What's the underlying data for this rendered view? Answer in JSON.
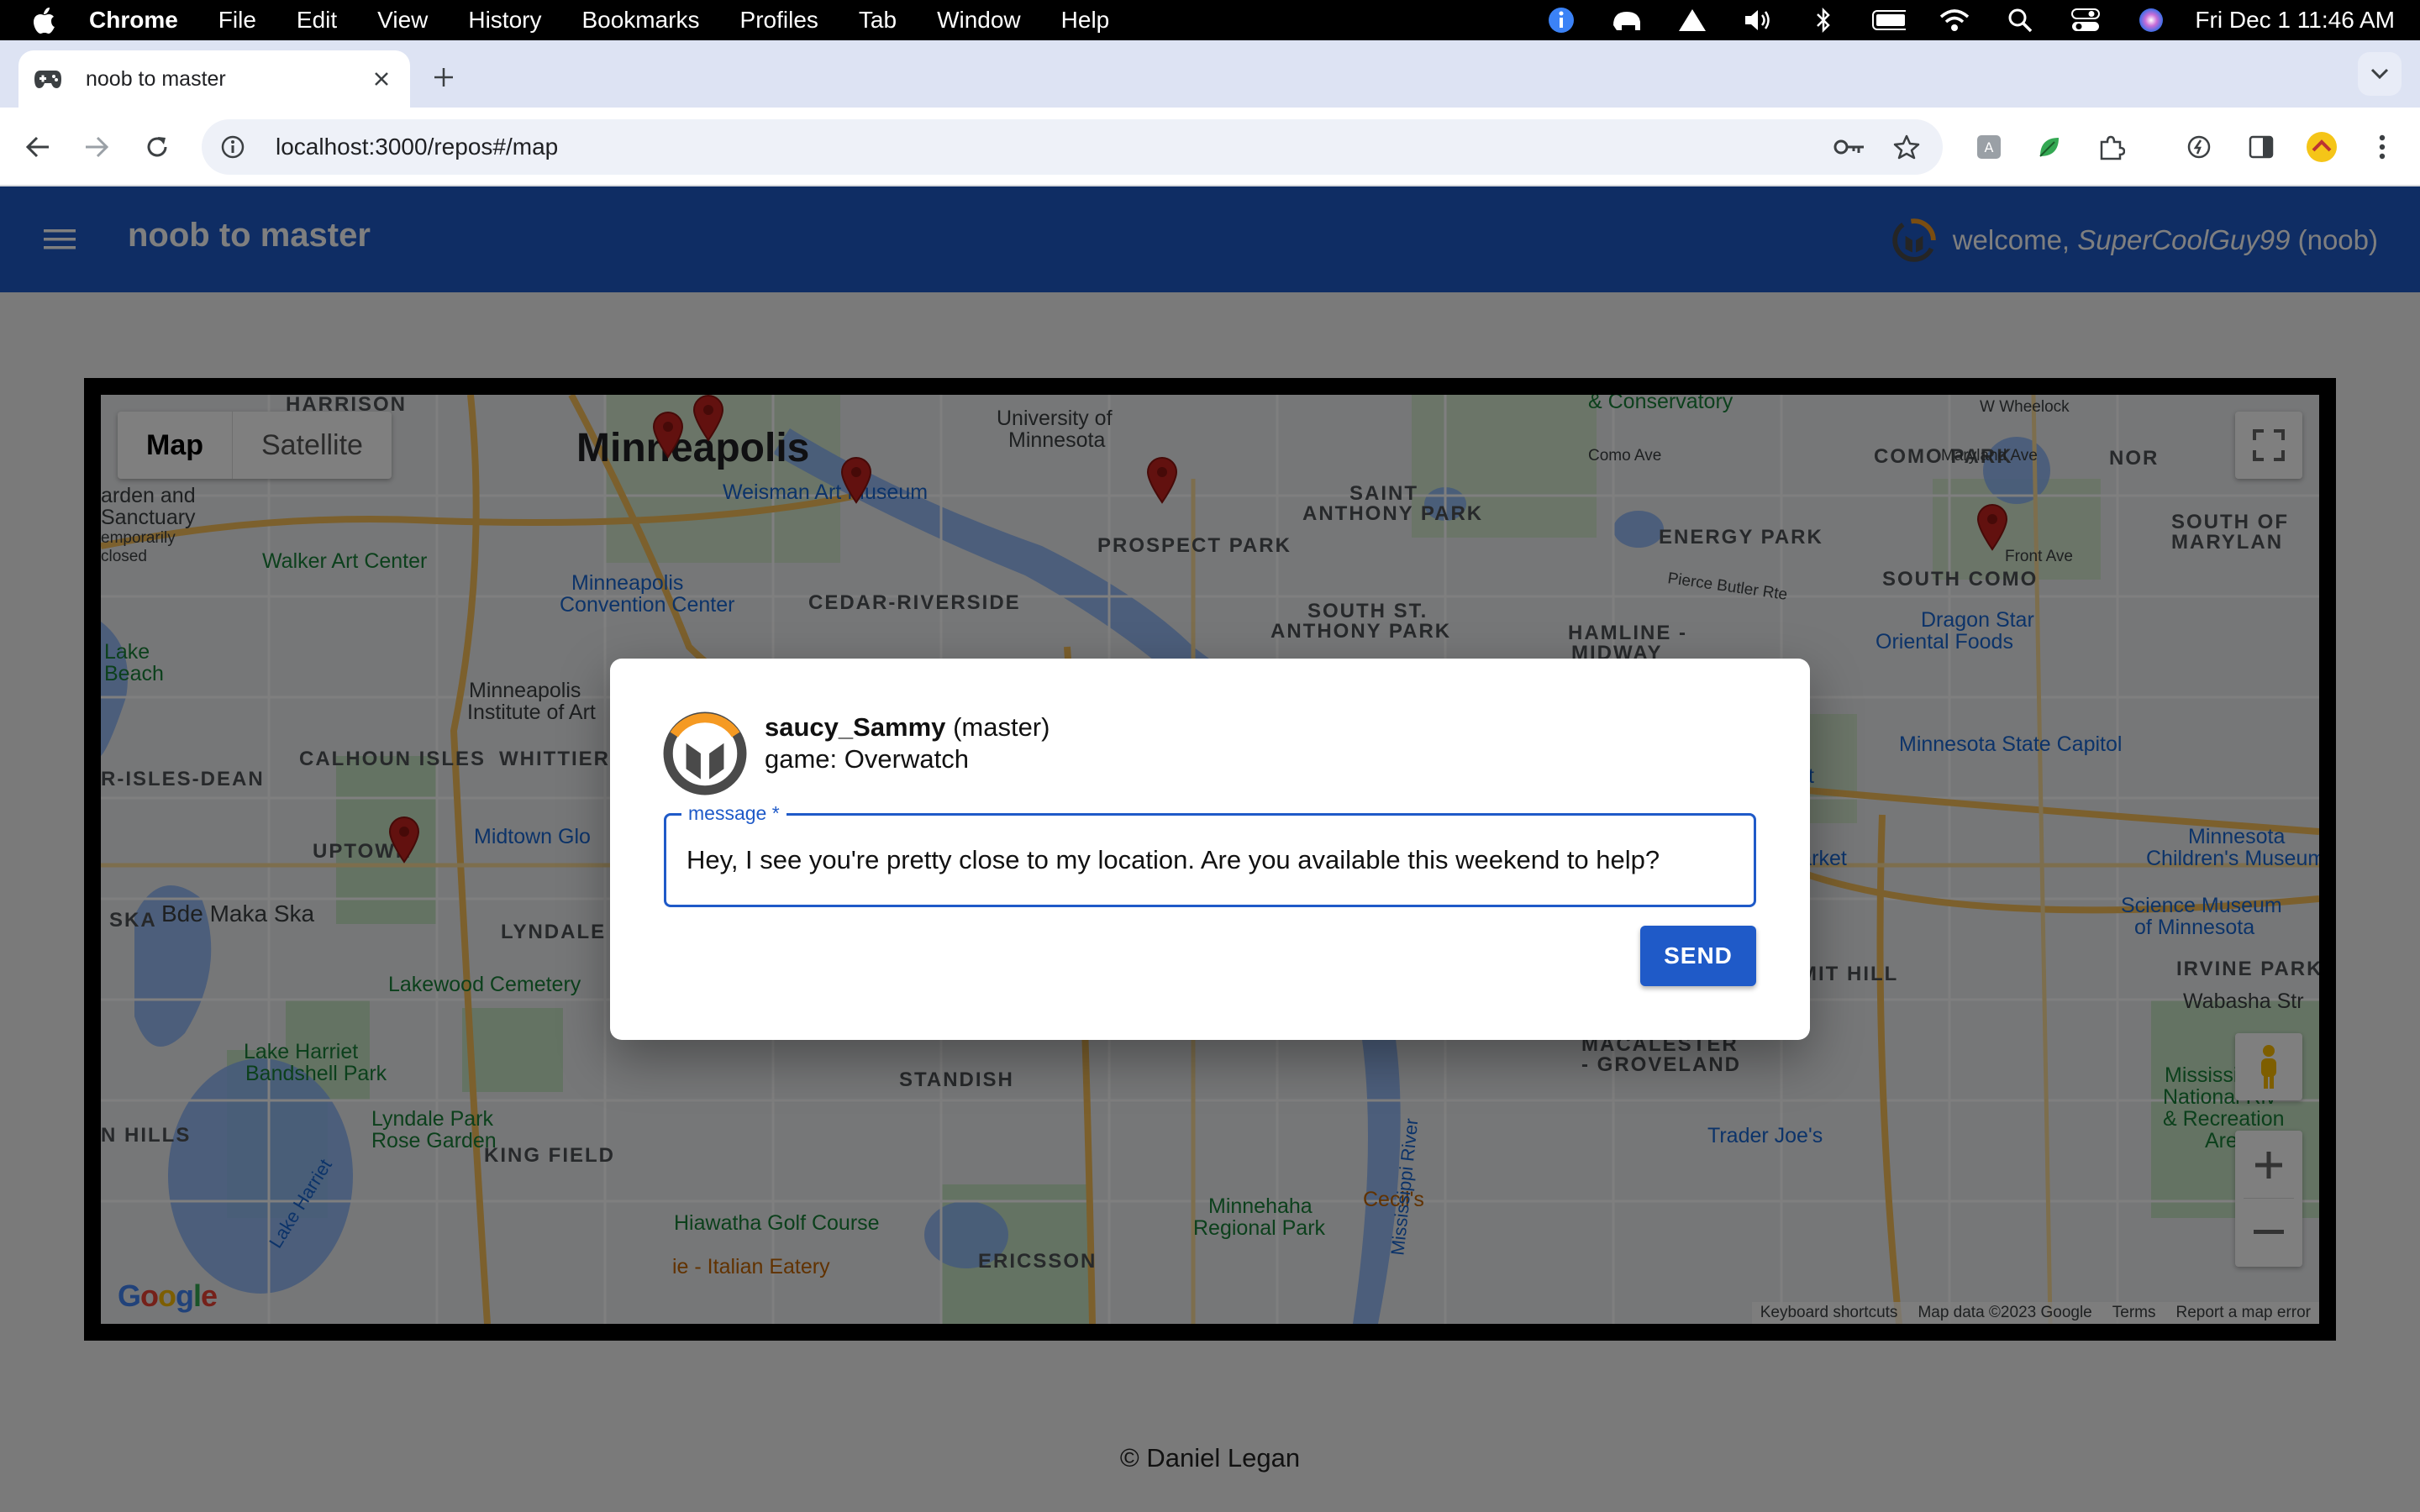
{
  "menubar": {
    "app_name": "Chrome",
    "items": [
      "File",
      "Edit",
      "View",
      "History",
      "Bookmarks",
      "Profiles",
      "Tab",
      "Window",
      "Help"
    ],
    "clock": "Fri Dec 1  11:46 AM"
  },
  "browser": {
    "tab_title": "noob to master",
    "url": "localhost:3000/repos#/map"
  },
  "app": {
    "brand": "noob to master",
    "welcome_prefix": "welcome,",
    "username": "SuperCoolGuy99",
    "user_rank": "(noob)",
    "footer": "© Daniel Legan"
  },
  "map": {
    "type_map": "Map",
    "type_satellite": "Satellite",
    "google": "Google",
    "attribution": {
      "shortcuts": "Keyboard shortcuts",
      "data": "Map data ©2023 Google",
      "terms": "Terms",
      "report": "Report a map error"
    },
    "labels": {
      "minneapolis": "Minneapolis",
      "harrison": "HARRISON",
      "university": "University of",
      "university2": "Minnesota",
      "weisman": "Weisman Art Museum",
      "saint_anthony_park": "SAINT",
      "saint_anthony_park2": "ANTHONY PARK",
      "prospect_park": "PROSPECT PARK",
      "como_park": "COMO PARK",
      "energy_park": "ENERGY PARK",
      "south_como": "SOUTH COMO",
      "walker": "Walker Art Center",
      "convention": "Minneapolis",
      "convention2": "Convention Center",
      "cedar_riverside": "CEDAR-RIVERSIDE",
      "south_st_anthony": "SOUTH ST.",
      "south_st_anthony2": "ANTHONY PARK",
      "hamline": "HAMLINE -",
      "hamline2": "MIDWAY",
      "dragon_star": "Dragon Star",
      "dragon_star2": "Oriental Foods",
      "lake_beach": "Lake",
      "lake_beach2": "Beach",
      "mia": "Minneapolis",
      "mia2": "Institute of Art",
      "calhoun": "CALHOUN ISLES",
      "whittier": "WHITTIER",
      "isles_dean": "R-ISLES-DEAN",
      "uptown": "UPTOWN",
      "midtown": "Midtown Glo",
      "state_capitol": "Minnesota State Capitol",
      "target": "arget",
      "market": "s Market",
      "childrens": "Children's Museum",
      "childrens_pre": "Minnesota",
      "science": "Science Museum",
      "science2": "of Minnesota",
      "bde_maka": "Bde Maka Ska",
      "ska": "SKA",
      "lyndale": "LYNDALE",
      "lakewood": "Lakewood Cemetery",
      "summit_hill": "MMIT HILL",
      "irvine": "IRVINE PARK",
      "wabasha": "Wabasha Str",
      "lake_harriet": "Lake Harriet",
      "lake_harriet2": "Bandshell Park",
      "lyndale_rose": "Lyndale Park",
      "lyndale_rose2": "Rose Garden",
      "standish": "STANDISH",
      "macalester": "MACALESTER",
      "macalester2": "- GROVELAND",
      "mississippi": "Mississippi",
      "mississippi2": "National Riv",
      "mississippi3": "& Recreation",
      "mississippi4": "Area",
      "hills": "N HILLS",
      "king_field": "KING FIELD",
      "trader_joes": "Trader Joe's",
      "cecils": "Cecil's",
      "minnehaha": "Minnehaha",
      "minnehaha2": "Regional Park",
      "hiawatha": "Hiawatha Golf Course",
      "ericsson": "ERICSSON",
      "italian": "ie - Italian Eatery",
      "lake_harriet_water": "Lake Harriet",
      "river": "Mississippi River",
      "nor": "NOR",
      "south_of": "SOUTH OF",
      "maryland": "MARYLAN",
      "como_ave": "Como Ave",
      "w_wheelock": "W Wheelock",
      "maryland_ave": "Maryland Ave",
      "front_ave": "Front Ave",
      "pierce": "Pierce Butler Rte",
      "conservatory": "& Conservatory",
      "sanctuary": "arden and",
      "sanctuary2": "Sanctuary",
      "sanctuary3": "emporarily",
      "sanctuary4": "closed"
    }
  },
  "modal": {
    "username": "saucy_Sammy",
    "rank": "(master)",
    "game": "game: Overwatch",
    "field_label": "message *",
    "message": "Hey, I see you're pretty close to my location. Are you available this weekend to help?",
    "send": "SEND"
  },
  "colors": {
    "appbar": "#1f5ac8",
    "overwatch_orange": "#f59a23",
    "overwatch_gray": "#4a4a4a",
    "pin": "#c5221f"
  }
}
